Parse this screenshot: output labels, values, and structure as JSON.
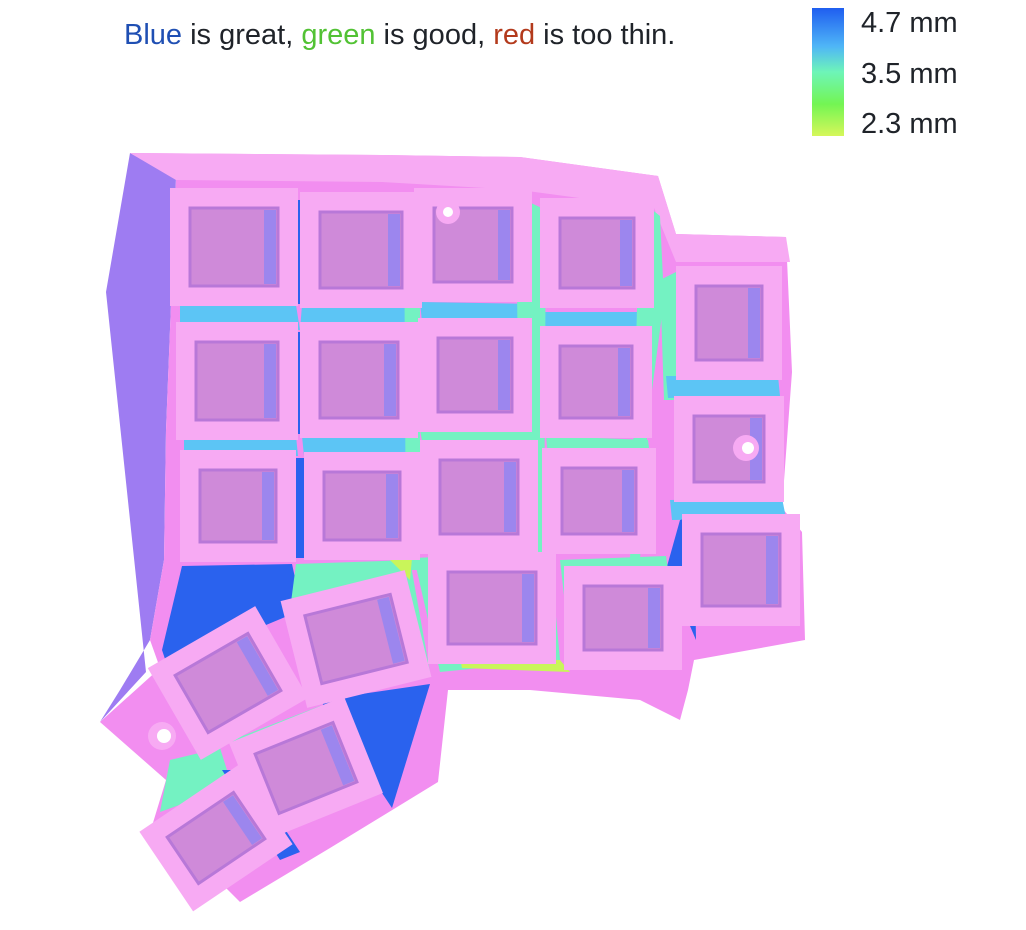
{
  "caption": {
    "blue_word": "Blue",
    "seg1": " is great, ",
    "green_word": "green",
    "seg2": " is good, ",
    "red_word": "red",
    "seg3": " is too thin."
  },
  "legend": {
    "max_label": "4.7 mm",
    "mid_label": "3.5 mm",
    "min_label": "2.3 mm",
    "colors": [
      "#1f5ef0",
      "#4fb6f7",
      "#6ef5b8",
      "#73f553",
      "#d6f75a"
    ]
  },
  "model": {
    "palette": {
      "shell": "#f28ef0",
      "shell_light": "#f7aaf3",
      "side": "#9e7cf2",
      "well": "#cf8ad9",
      "thick": "#2a62ee",
      "medium": "#5cc5f5",
      "good": "#74f2c2",
      "thin": "#c9f55a",
      "web": "#e6eef5"
    },
    "key_count": 23
  }
}
